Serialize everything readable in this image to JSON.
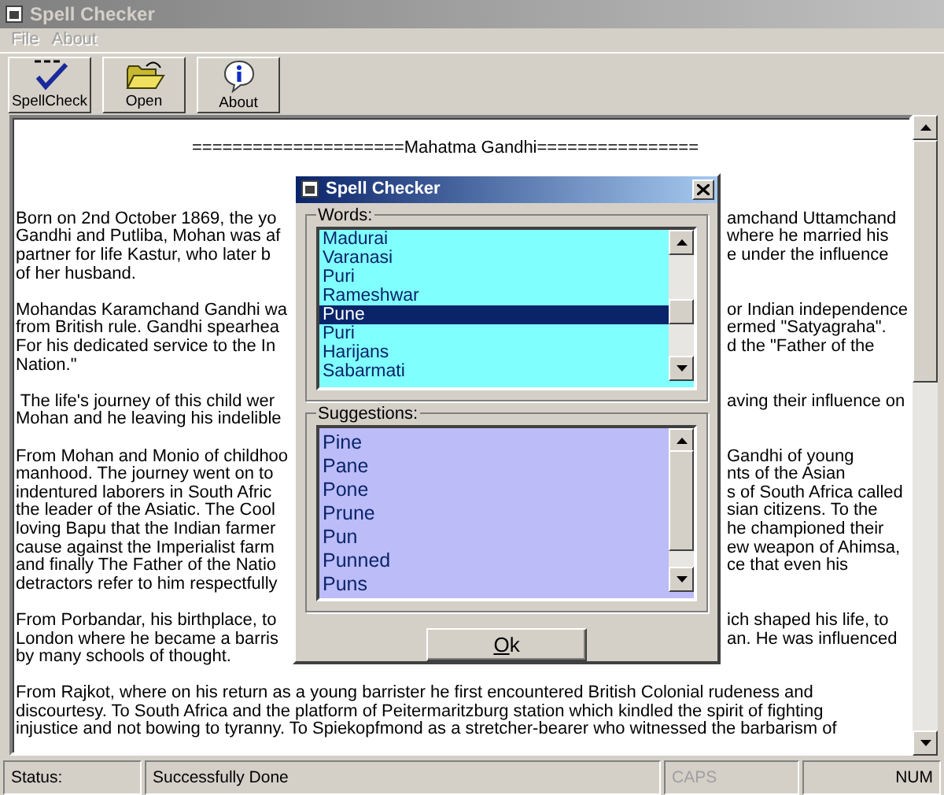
{
  "window": {
    "title": "Spell Checker"
  },
  "menu": [
    {
      "label": "File",
      "disabled": true
    },
    {
      "label": "About",
      "disabled": true
    }
  ],
  "toolbar": [
    {
      "kind": "spell",
      "label": "SpellCheck"
    },
    {
      "kind": "open",
      "label": "Open"
    },
    {
      "kind": "about",
      "label": "About"
    }
  ],
  "document": {
    "heading": "=====================Mahatma Gandhi================",
    "paragraphs": [
      [
        {
          "left": "Born on 2nd October 1869, the yo",
          "right": "amchand Uttamchand"
        },
        {
          "left": "Gandhi and Putliba, Mohan was af",
          "right": "where he married his"
        },
        {
          "left": "partner for life Kastur, who later b",
          "right": "e under the influence"
        },
        {
          "left": "of her husband."
        }
      ],
      [
        {
          "left": "Mohandas Karamchand Gandhi wa",
          "right": "or Indian independence"
        },
        {
          "left": "from British rule. Gandhi spearhea",
          "right": "ermed \"Satyagraha\"."
        },
        {
          "left": "For his dedicated service to the In",
          "right": "d the \"Father of the"
        },
        {
          "left": "Nation.\""
        }
      ],
      [
        {
          "left": " The life's journey of this child wer",
          "right": "aving their influence on"
        },
        {
          "left": "Mohan and he leaving his indelible"
        }
      ],
      [
        {
          "left": "From Mohan and Monio of childhoo",
          "right": "Gandhi of young"
        },
        {
          "left": "manhood. The journey went on to",
          "right": "nts of the Asian"
        },
        {
          "left": "indentured laborers in South Afric",
          "right": "s of South Africa called"
        },
        {
          "left": "the leader of the Asiatic. The Cool",
          "right": "sian citizens. To the"
        },
        {
          "left": "loving Bapu that the Indian farmer",
          "right": "he championed their"
        },
        {
          "left": "cause against the Imperialist farm",
          "right": "ew weapon of Ahimsa,"
        },
        {
          "left": "and finally The Father of the Natio",
          "right": "ce that even his"
        },
        {
          "left": "detractors refer to him respectfully"
        }
      ],
      [
        {
          "left": "From Porbandar, his birthplace, to",
          "right": "ich shaped his life, to"
        },
        {
          "left": "London where he became a barris",
          "right": "an. He was influenced"
        },
        {
          "left": "by many schools of thought."
        }
      ],
      [
        {
          "left": "From Rajkot, where on his return as a young barrister he first encountered British Colonial rudeness and"
        },
        {
          "left": "discourtesy. To South Africa and the platform of Peitermaritzburg station which kindled the spirit of fighting"
        },
        {
          "left": "injustice and not bowing to tyranny. To Spiekopfmond as a stretcher-bearer who witnessed the barbarism of"
        }
      ]
    ]
  },
  "dialog": {
    "title": "Spell Checker",
    "words_label": "Words:",
    "words": [
      {
        "label": "Madurai",
        "selected": false
      },
      {
        "label": "Varanasi",
        "selected": false
      },
      {
        "label": "Puri",
        "selected": false
      },
      {
        "label": "Rameshwar",
        "selected": false
      },
      {
        "label": "Pune",
        "selected": true
      },
      {
        "label": "Puri",
        "selected": false
      },
      {
        "label": "Harijans",
        "selected": false
      },
      {
        "label": "Sabarmati",
        "selected": false
      }
    ],
    "suggestions_label": "Suggestions:",
    "suggestions": [
      {
        "label": "Pine",
        "selected": false
      },
      {
        "label": "Pane",
        "selected": false
      },
      {
        "label": "Pone",
        "selected": false
      },
      {
        "label": "Prune",
        "selected": false
      },
      {
        "label": "Pun",
        "selected": false
      },
      {
        "label": "Punned",
        "selected": false
      },
      {
        "label": "Puns",
        "selected": false
      }
    ],
    "ok_button": {
      "label": "Ok"
    }
  },
  "status_bar": [
    {
      "text": "Status:",
      "disabled": false
    },
    {
      "text": "Successfully Done",
      "disabled": false
    },
    {
      "text": "CAPS",
      "disabled": true
    },
    {
      "text": "NUM",
      "disabled": false
    }
  ]
}
